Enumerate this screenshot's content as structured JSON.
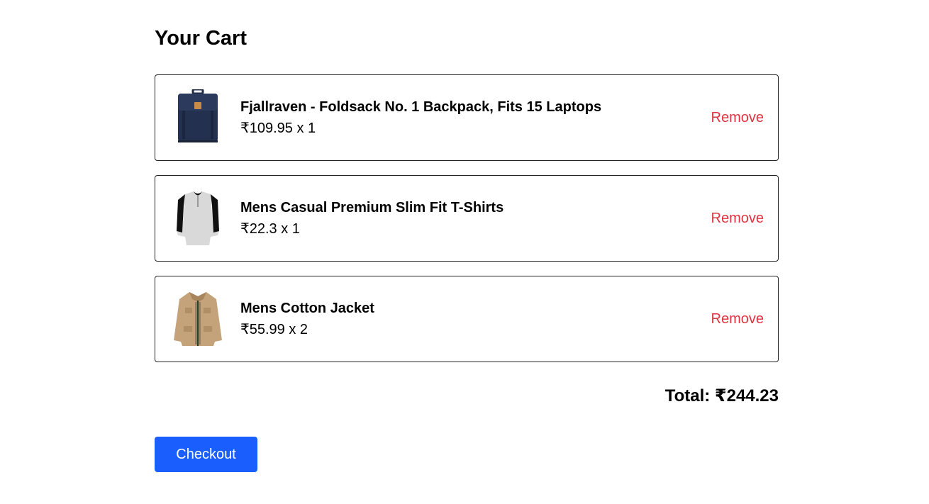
{
  "cart": {
    "title": "Your Cart",
    "items": [
      {
        "name": "Fjallraven - Foldsack No. 1 Backpack, Fits 15 Laptops",
        "price_line": "₹109.95 x 1",
        "price": 109.95,
        "quantity": 1,
        "image_icon": "backpack-icon",
        "remove_label": "Remove"
      },
      {
        "name": "Mens Casual Premium Slim Fit T-Shirts",
        "price_line": "₹22.3 x 1",
        "price": 22.3,
        "quantity": 1,
        "image_icon": "tshirt-icon",
        "remove_label": "Remove"
      },
      {
        "name": "Mens Cotton Jacket",
        "price_line": "₹55.99 x 2",
        "price": 55.99,
        "quantity": 2,
        "image_icon": "jacket-icon",
        "remove_label": "Remove"
      }
    ],
    "total_text": "Total: ₹244.23",
    "checkout_label": "Checkout"
  },
  "colors": {
    "remove": "#e0323f",
    "checkout_bg": "#1a5ffe",
    "checkout_text": "#ffffff",
    "border": "#222222"
  }
}
